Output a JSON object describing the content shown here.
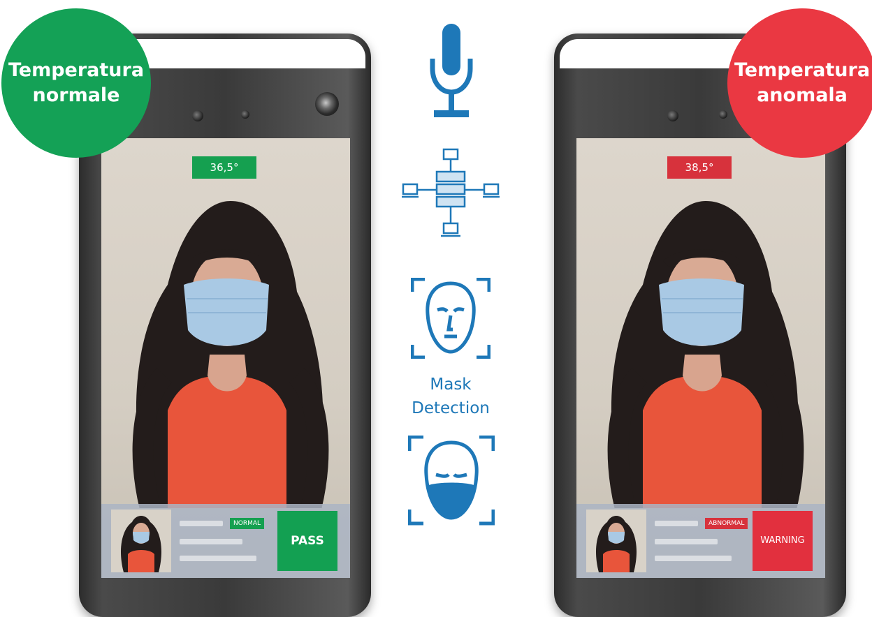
{
  "badges": {
    "normal": {
      "line1": "Temperatura",
      "line2": "normale",
      "color": "#14a156"
    },
    "abnormal": {
      "line1": "Temperatura",
      "line2": "anomala",
      "color": "#ea3842"
    }
  },
  "devices": [
    {
      "temperature": "36,5°",
      "status": "NORMAL",
      "result": "PASS",
      "color": "#15a050"
    },
    {
      "temperature": "38,5°",
      "status": "ABNORMAL",
      "result": "WARNING",
      "color": "#d7323c"
    }
  ],
  "features": {
    "icons": [
      "microphone-icon",
      "network-server-icon",
      "face-scan-icon",
      "masked-face-scan-icon"
    ],
    "mask_line1": "Mask",
    "mask_line2": "Detection",
    "accent": "#1e78b8"
  }
}
